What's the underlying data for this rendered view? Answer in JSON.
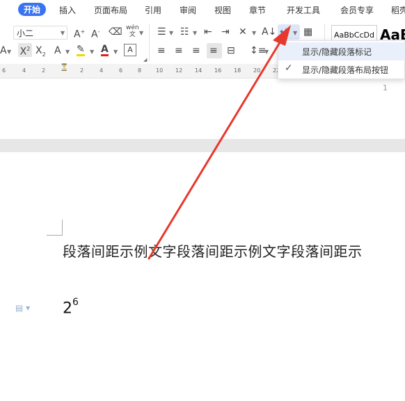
{
  "tabs": [
    {
      "label": "开始",
      "active": true
    },
    {
      "label": "插入"
    },
    {
      "label": "页面布局"
    },
    {
      "label": "引用"
    },
    {
      "label": "审阅"
    },
    {
      "label": "视图"
    },
    {
      "label": "章节"
    },
    {
      "label": "开发工具"
    },
    {
      "label": "会员专享"
    },
    {
      "label": "稻壳"
    }
  ],
  "ribbon": {
    "font_size": "小二",
    "style_preview": "AaBbCcDd",
    "style_big": "AaB",
    "phonetic_label": "wén"
  },
  "ruler": {
    "ticks": [
      "6",
      "4",
      "2",
      "2",
      "4",
      "6",
      "8",
      "10",
      "12",
      "14",
      "16",
      "18",
      "20",
      "22"
    ]
  },
  "dropdown": {
    "items": [
      {
        "label": "显示/隐藏段落标记",
        "checked": false,
        "hover": true
      },
      {
        "label": "显示/隐藏段落布局按钮",
        "checked": true
      }
    ]
  },
  "document": {
    "page_number": "1",
    "body_text": "段落间距示例文字段落间距示例文字段落间距示",
    "formula_base": "2",
    "formula_exponent": "6"
  },
  "colors": {
    "accent": "#3a73f0",
    "arrow": "#e8372c",
    "highlight": "#f5d400",
    "font_color": "#e02020"
  }
}
